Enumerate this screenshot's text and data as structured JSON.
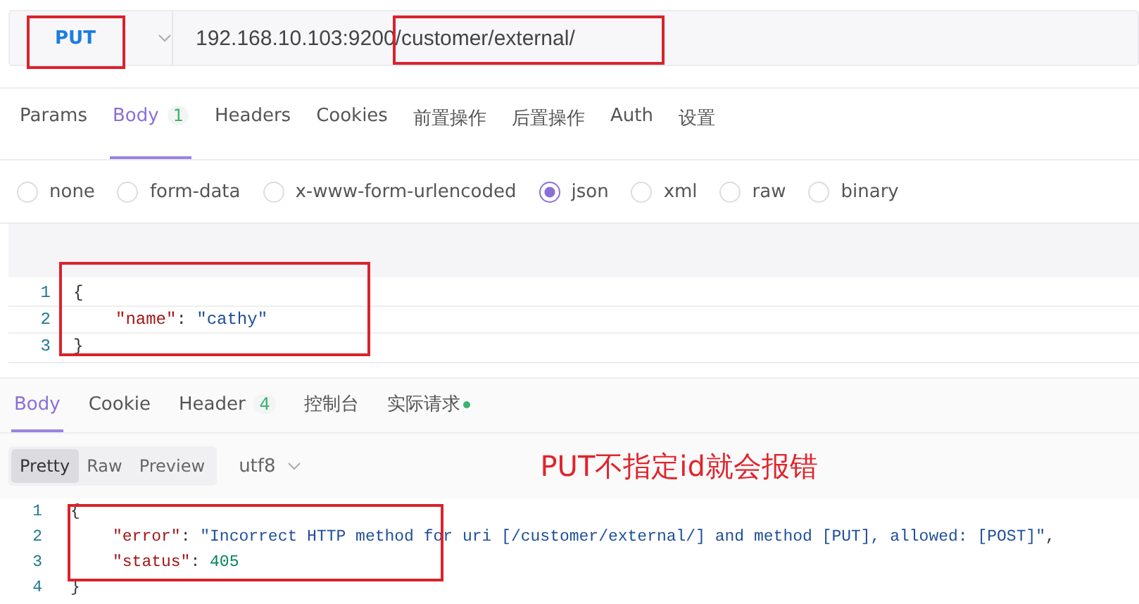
{
  "request": {
    "method": "PUT",
    "url": "192.168.10.103:9200/customer/external/"
  },
  "request_tabs": [
    {
      "label": "Params",
      "selected": false
    },
    {
      "label": "Body",
      "count": "1",
      "selected": true
    },
    {
      "label": "Headers",
      "selected": false
    },
    {
      "label": "Cookies",
      "selected": false
    },
    {
      "label": "前置操作",
      "selected": false
    },
    {
      "label": "后置操作",
      "selected": false
    },
    {
      "label": "Auth",
      "selected": false
    },
    {
      "label": "设置",
      "selected": false
    }
  ],
  "body_types": [
    {
      "label": "none",
      "selected": false
    },
    {
      "label": "form-data",
      "selected": false
    },
    {
      "label": "x-www-form-urlencoded",
      "selected": false
    },
    {
      "label": "json",
      "selected": true
    },
    {
      "label": "xml",
      "selected": false
    },
    {
      "label": "raw",
      "selected": false
    },
    {
      "label": "binary",
      "selected": false
    }
  ],
  "request_body": [
    {
      "number": "1",
      "indented": false,
      "tokens": [
        {
          "kind": "punct",
          "text": "{"
        }
      ]
    },
    {
      "number": "2",
      "indented": true,
      "tokens": [
        {
          "kind": "key",
          "text": "\"name\""
        },
        {
          "kind": "punct",
          "text": ": "
        },
        {
          "kind": "string",
          "text": "\"cathy\""
        }
      ]
    },
    {
      "number": "3",
      "indented": false,
      "tokens": [
        {
          "kind": "punct",
          "text": "}"
        }
      ]
    }
  ],
  "response_tabs": [
    {
      "label": "Body",
      "selected": true
    },
    {
      "label": "Cookie",
      "selected": false
    },
    {
      "label": "Header",
      "count": "4",
      "selected": false
    },
    {
      "label": "控制台",
      "selected": false
    },
    {
      "label": "实际请求",
      "dot": true,
      "selected": false
    }
  ],
  "view_modes": [
    {
      "label": "Pretty",
      "selected": true
    },
    {
      "label": "Raw",
      "selected": false
    },
    {
      "label": "Preview",
      "selected": false
    }
  ],
  "encoding": "utf8",
  "annotation": "PUT不指定id就会报错",
  "response_body": [
    {
      "number": "1",
      "indented": false,
      "tokens": [
        {
          "kind": "punct",
          "text": "{"
        }
      ]
    },
    {
      "number": "2",
      "indented": true,
      "tokens": [
        {
          "kind": "key",
          "text": "\"error\""
        },
        {
          "kind": "punct",
          "text": ": "
        },
        {
          "kind": "string",
          "text": "\"Incorrect HTTP method for uri [/customer/external/] and method [PUT], allowed: [POST]\""
        },
        {
          "kind": "punct",
          "text": ","
        }
      ]
    },
    {
      "number": "3",
      "indented": true,
      "tokens": [
        {
          "kind": "key",
          "text": "\"status\""
        },
        {
          "kind": "punct",
          "text": ": "
        },
        {
          "kind": "number",
          "text": "405"
        }
      ]
    },
    {
      "number": "4",
      "indented": false,
      "tokens": [
        {
          "kind": "punct",
          "text": "}"
        }
      ]
    }
  ]
}
